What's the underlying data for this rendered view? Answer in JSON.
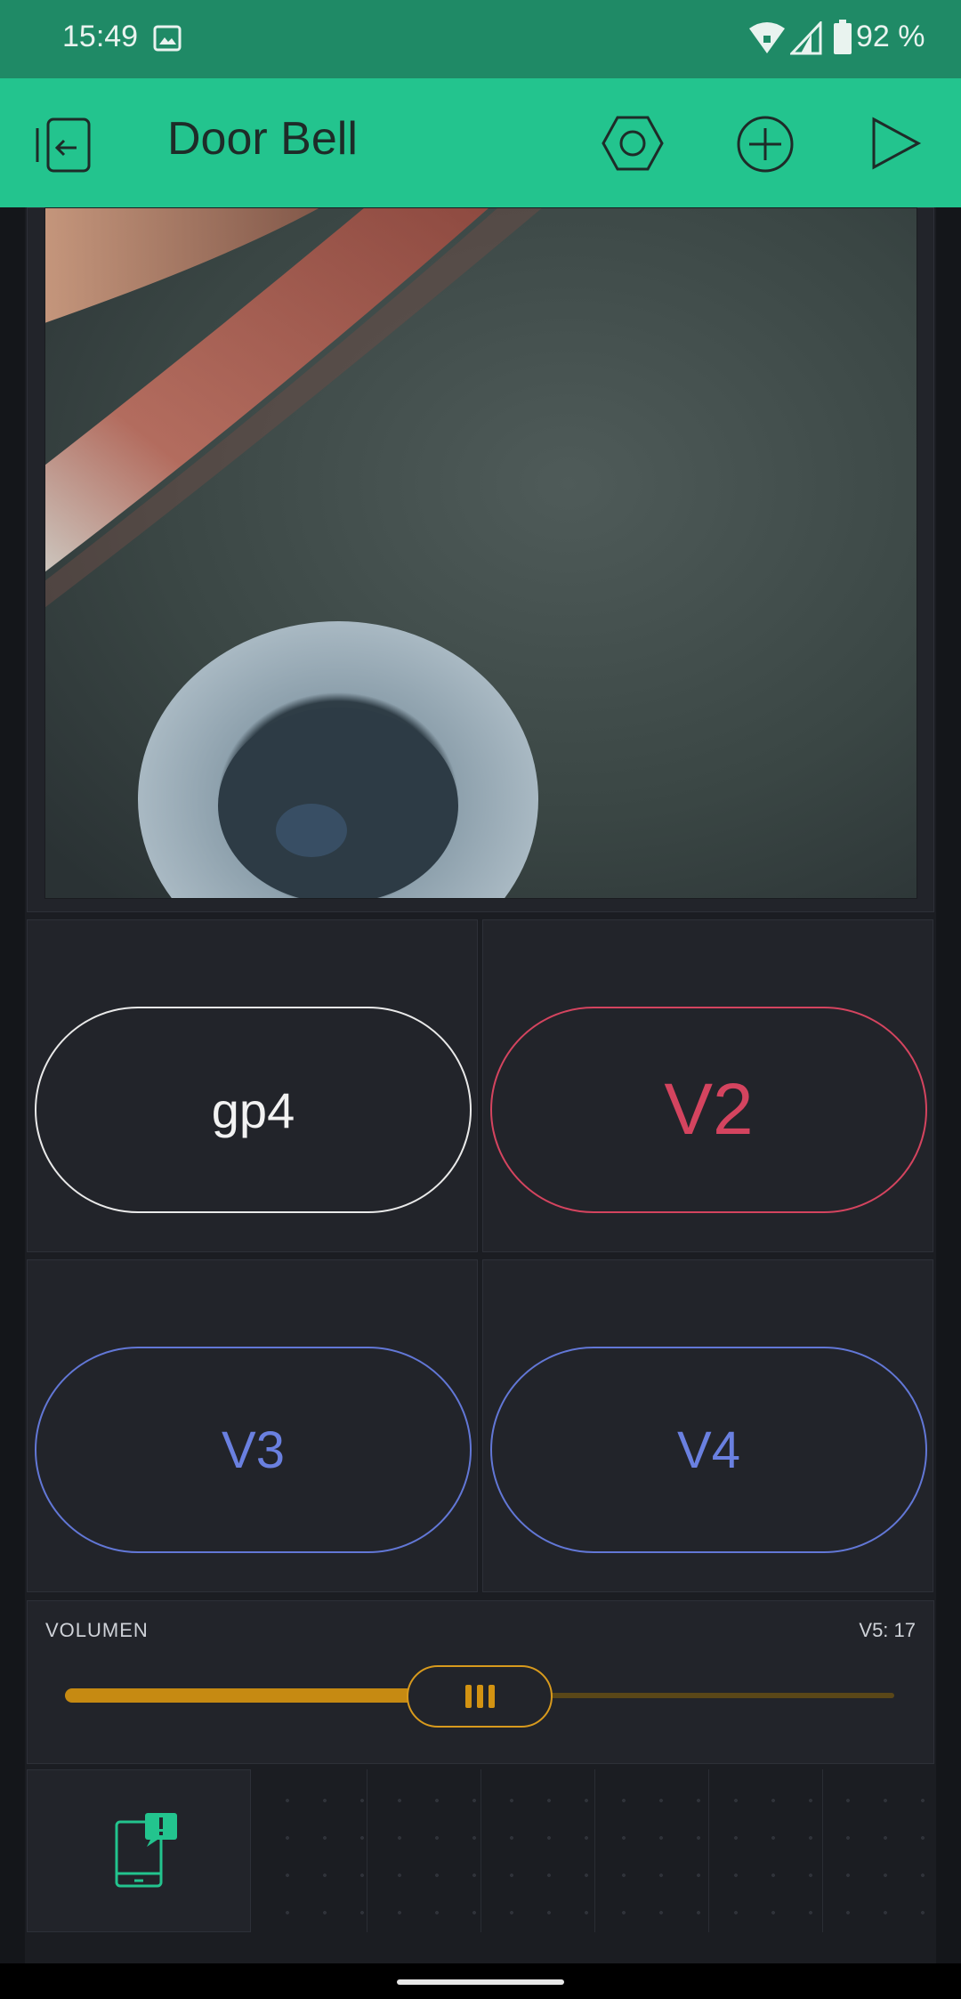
{
  "status_bar": {
    "time": "15:49",
    "battery": "92 %"
  },
  "app_bar": {
    "title": "Door Bell"
  },
  "buttons": [
    {
      "label": "gp4",
      "style": "white"
    },
    {
      "label": "V2",
      "style": "red"
    },
    {
      "label": "V3",
      "style": "blue"
    },
    {
      "label": "V4",
      "style": "blue"
    }
  ],
  "slider": {
    "label": "VOLUMEN",
    "value_text": "V5: 17",
    "level_fraction": 0.5
  },
  "colors": {
    "accent_green": "#23c48e",
    "red": "#d4445f",
    "blue": "#6277d6",
    "amber": "#c68a12"
  }
}
